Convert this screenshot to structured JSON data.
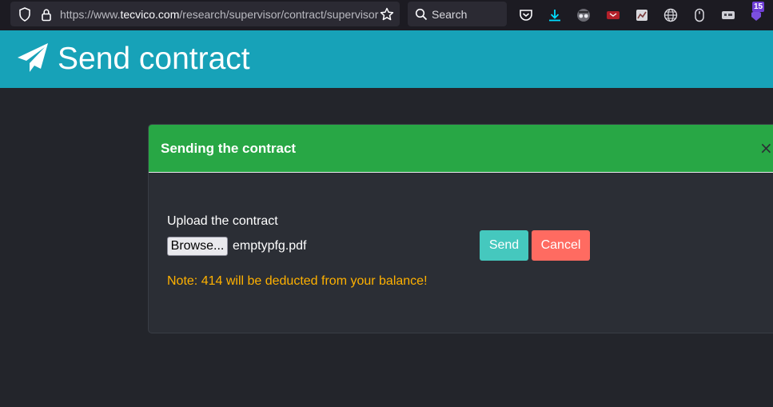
{
  "browser": {
    "url_prefix": "https://www.",
    "url_host": "tecvico.com",
    "url_path": "/research/supervisor/contract/supervisor",
    "search_placeholder": "Search",
    "extension_badge": "15"
  },
  "header": {
    "title": "Send contract",
    "bg_color": "#17a2b8"
  },
  "modal": {
    "title": "Sending the contract",
    "close_label": "×",
    "upload_label": "Upload the contract",
    "browse_label": "Browse...",
    "file_name": "emptypfg.pdf",
    "send_label": "Send",
    "cancel_label": "Cancel",
    "note": "Note: 414 will be deducted from your balance!",
    "header_color": "#28a745",
    "send_color": "#45c8be",
    "cancel_color": "#ff6b61",
    "note_color": "#ffb100"
  },
  "icons": {
    "header": "paper-plane-icon",
    "toolbar": [
      "shield-icon",
      "lock-icon",
      "star-icon",
      "search-icon",
      "pocket-icon",
      "download-icon",
      "extension-icons"
    ]
  }
}
